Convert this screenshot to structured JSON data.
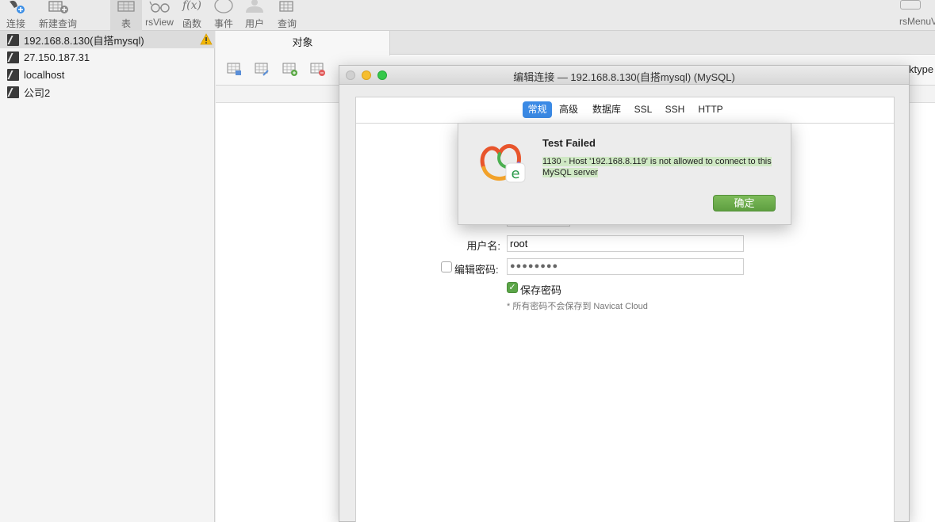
{
  "toolbar": {
    "connect_label": "连接",
    "new_query_label": "新建查询",
    "table_label": "表",
    "view_label": "rsView",
    "function_label": "函数",
    "event_label": "事件",
    "user_label": "用户",
    "query_label": "查询",
    "right_label": "rsMenuV"
  },
  "sidebar": {
    "connections": [
      {
        "name": "192.168.8.130(自搭mysql)",
        "warning": true
      },
      {
        "name": "27.150.187.31"
      },
      {
        "name": "localhost"
      },
      {
        "name": "公司2"
      }
    ]
  },
  "main": {
    "tab_objects": "对象",
    "ktype_text": "ktype"
  },
  "dialog": {
    "title": "编辑连接 — 192.168.8.130(自搭mysql) (MySQL)",
    "tabs": [
      "常规",
      "高级",
      "数据库",
      "SSL",
      "SSH",
      "HTTP"
    ],
    "selected_tab": "常规",
    "username_label": "用户名:",
    "username_value": "root",
    "edit_password_label": "编辑密码:",
    "password_mask": "●●●●●●●●",
    "save_password_label": "保存密码",
    "note": "* 所有密码不会保存到 Navicat Cloud"
  },
  "alert": {
    "title": "Test Failed",
    "message": "1130 - Host '192.168.8.119' is not allowed to connect to this MySQL server",
    "ok_label": "确定"
  },
  "colors": {
    "accent": "#3b8ae5",
    "ok_button": "#6aac4b",
    "warning": "#f2b705"
  }
}
